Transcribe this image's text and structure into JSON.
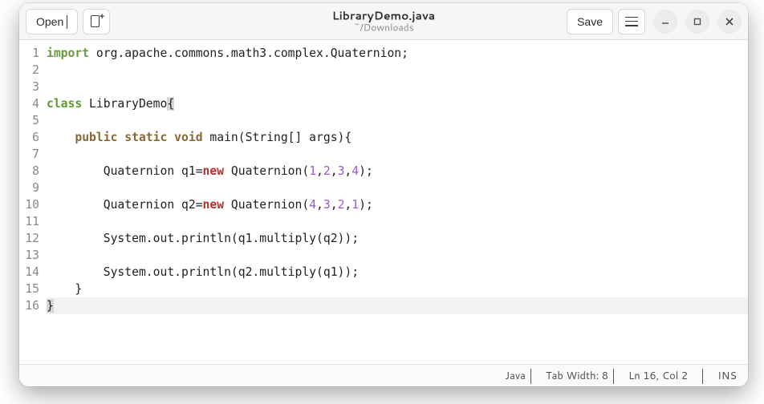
{
  "header": {
    "open_label": "Open",
    "title": "LibraryDemo.java",
    "subtitle": "~/Downloads",
    "save_label": "Save"
  },
  "code": {
    "lines": [
      {
        "n": 1,
        "kind": "import",
        "text_after_kw": " org.apache.commons.math3.complex.Quaternion;"
      },
      {
        "n": 2,
        "kind": "blank"
      },
      {
        "n": 3,
        "kind": "blank"
      },
      {
        "n": 4,
        "kind": "class",
        "name": " LibraryDemo",
        "trail": "{"
      },
      {
        "n": 5,
        "kind": "blank"
      },
      {
        "n": 6,
        "kind": "method",
        "prefix": "    ",
        "mods": "public static void",
        "rest": " main(String[] args){"
      },
      {
        "n": 7,
        "kind": "blank"
      },
      {
        "n": 8,
        "kind": "new",
        "pre": "        Quaternion q1=",
        "call": " Quaternion(",
        "nums": [
          "1",
          "2",
          "3",
          "4"
        ],
        "end": ");"
      },
      {
        "n": 9,
        "kind": "blank"
      },
      {
        "n": 10,
        "kind": "new",
        "pre": "        Quaternion q2=",
        "call": " Quaternion(",
        "nums": [
          "4",
          "3",
          "2",
          "1"
        ],
        "end": ");"
      },
      {
        "n": 11,
        "kind": "blank"
      },
      {
        "n": 12,
        "kind": "plain",
        "text": "        System.out.println(q1.multiply(q2));"
      },
      {
        "n": 13,
        "kind": "blank"
      },
      {
        "n": 14,
        "kind": "plain",
        "text": "        System.out.println(q2.multiply(q1));"
      },
      {
        "n": 15,
        "kind": "plain",
        "text": "    }"
      },
      {
        "n": 16,
        "kind": "end",
        "text": "}"
      }
    ]
  },
  "status": {
    "language": "Java",
    "tab_width_label": "Tab Width: 8",
    "position": "Ln 16, Col 2",
    "insert_mode": "INS"
  }
}
